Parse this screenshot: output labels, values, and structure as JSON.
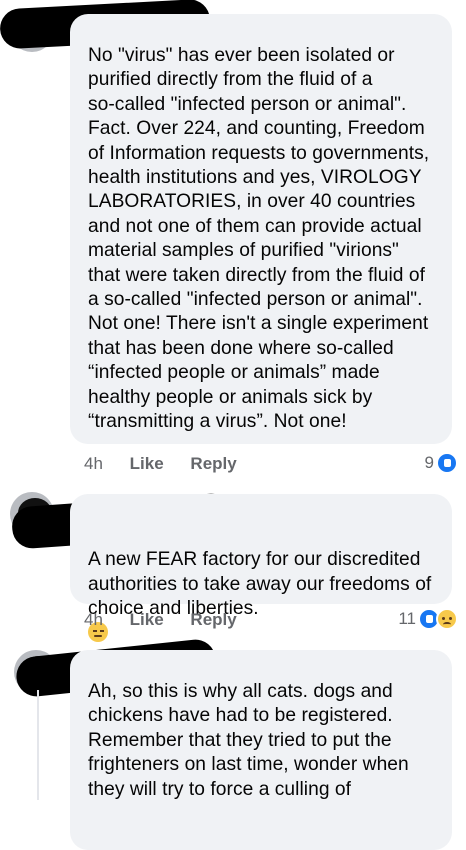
{
  "comments": [
    {
      "text": "No \"virus\" has ever been isolated or\npurified directly from the fluid of a\nso-called \"infected person or animal\".\nFact. Over 224, and counting, Freedom\nof Information requests to governments,\nhealth institutions and yes, VIROLOGY\nLABORATORIES, in over 40 countries\nand not one of them can provide actual\nmaterial samples of purified \"virions\"\nthat were taken directly from the fluid of\na so-called \"infected person or animal\".\nNot one! There isn't a single experiment\nthat has been done where so-called\n“infected people or animals” made\nhealthy people or animals sick by\n“transmitting a virus”. Not one!",
      "time": "4h",
      "like_label": "Like",
      "reply_label": "Reply",
      "reaction_count": "9",
      "reaction_icons": [
        "like-icon"
      ]
    },
    {
      "text": "A new FEAR factory for our discredited\nauthorities to take away our freedoms of\nchoice and liberties.",
      "emoji": "pensive-face-icon",
      "time": "4h",
      "like_label": "Like",
      "reply_label": "Reply",
      "reaction_count": "11",
      "reaction_icons": [
        "like-icon",
        "sad-icon"
      ]
    },
    {
      "text": "Ah, so this is why all cats. dogs and\nchickens have had to be registered.\nRemember that they tried to put the\nfrighteners on last time,  wonder when\nthey will try to force a culling of"
    }
  ]
}
